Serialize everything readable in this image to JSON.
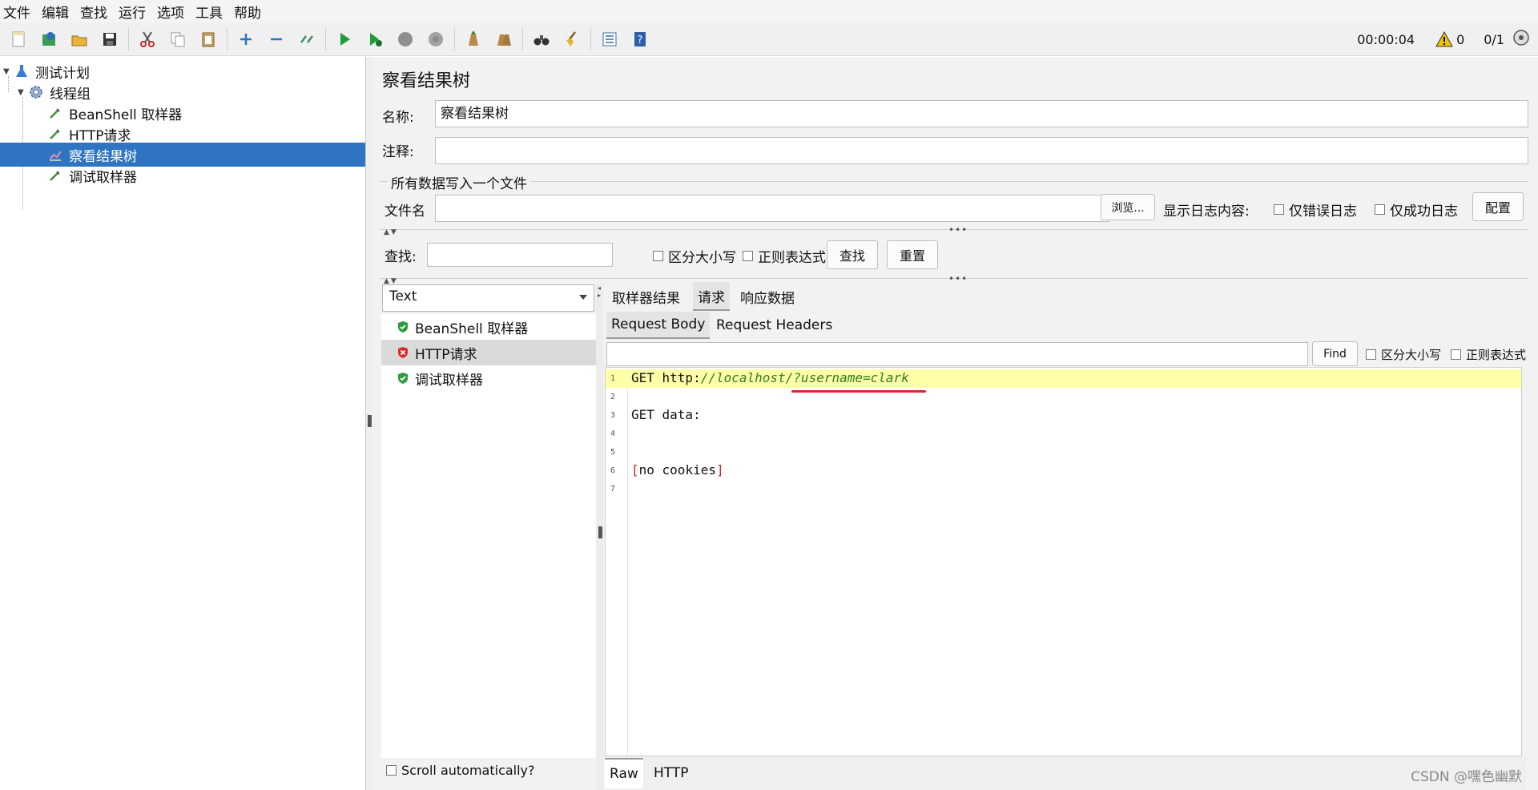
{
  "menu": [
    "文件",
    "编辑",
    "查找",
    "运行",
    "选项",
    "工具",
    "帮助"
  ],
  "toolbar": {
    "timer": "00:00:04",
    "warnings": "0",
    "threads": "0/1"
  },
  "tree": {
    "items": [
      {
        "label": "测试计划",
        "icon": "test-plan-icon"
      },
      {
        "label": "线程组",
        "icon": "gear-icon"
      },
      {
        "label": "BeanShell 取样器",
        "icon": "pipette-icon"
      },
      {
        "label": "HTTP请求",
        "icon": "pipette-icon"
      },
      {
        "label": "察看结果树",
        "icon": "chart-icon"
      },
      {
        "label": "调试取样器",
        "icon": "pipette-icon"
      }
    ]
  },
  "panel": {
    "title": "察看结果树",
    "name_label": "名称:",
    "name_value": "察看结果树",
    "comment_label": "注释:",
    "comment_value": "",
    "file_section": "所有数据写入一个文件",
    "filename_label": "文件名",
    "browse_label": "浏览...",
    "log_display_label": "显示日志内容:",
    "errors_only_label": "仅错误日志",
    "success_only_label": "仅成功日志",
    "config_label": "配置",
    "search_label": "查找:",
    "case_label": "区分大小写",
    "regex_label": "正则表达式",
    "find_label": "查找",
    "reset_label": "重置"
  },
  "results": {
    "renderer": "Text",
    "items": [
      {
        "label": "BeanShell 取样器",
        "status": "success"
      },
      {
        "label": "HTTP请求",
        "status": "error"
      },
      {
        "label": "调试取样器",
        "status": "success"
      }
    ],
    "scroll_label": "Scroll automatically?"
  },
  "response": {
    "tabs": [
      "取样器结果",
      "请求",
      "响应数据"
    ],
    "subtabs": [
      "Request Body",
      "Request Headers"
    ],
    "find_label": "Find",
    "case_label": "区分大小写",
    "regex_label": "正则表达式",
    "lines": [
      "1",
      "2",
      "3",
      "4",
      "5",
      "6",
      "7"
    ],
    "line1_method": "GET http:",
    "line1_url": "//localhost/?username=clark",
    "line3": "GET data:",
    "line6_text": "no cookies",
    "bottom_tabs": [
      "Raw",
      "HTTP"
    ]
  },
  "watermark": "CSDN @嘿色幽默",
  "colors": {
    "selection": "#2f74c0",
    "highlight": "#ffffa8",
    "url": "#2f7d1e",
    "annotation": "#e8202a"
  }
}
